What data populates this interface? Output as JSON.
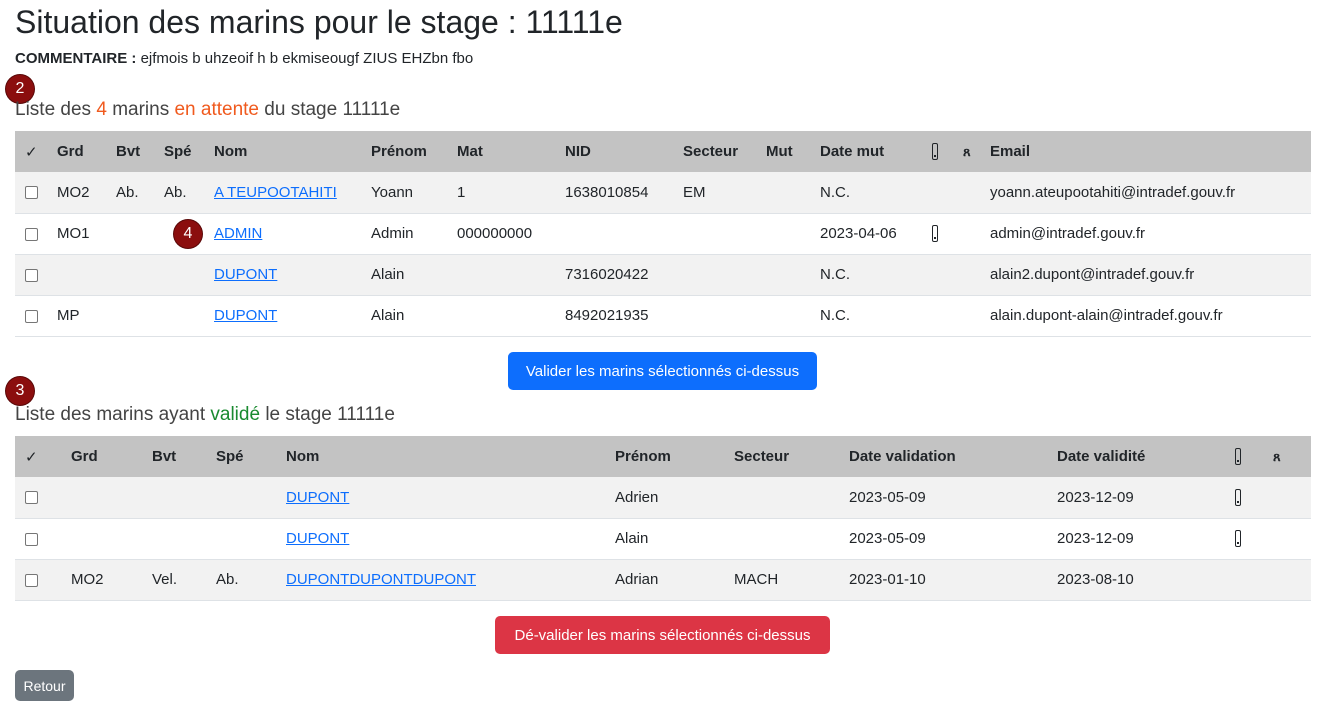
{
  "page": {
    "title": "Situation des marins pour le stage : 11111e",
    "comment_label": "COMMENTAIRE :",
    "comment_value": "ejfmois b uhzeoif h b ekmiseougf ZIUS EHZbn fbo"
  },
  "markers": [
    "2",
    "3",
    "4"
  ],
  "pending": {
    "title_prefix": "Liste des",
    "count": "4",
    "title_mid": "marins",
    "status": "en attente",
    "title_suffix": "du stage 11111e",
    "headers": {
      "check": "✓",
      "grd": "Grd",
      "bvt": "Bvt",
      "spe": "Spé",
      "nom": "Nom",
      "prenom": "Prénom",
      "mat": "Mat",
      "nid": "NID",
      "secteur": "Secteur",
      "mut": "Mut",
      "date_mut": "Date mut",
      "email": "Email"
    },
    "rows": [
      {
        "grd": "MO2",
        "bvt": "Ab.",
        "spe": "Ab.",
        "nom": "A TEUPOOTAHITI",
        "prenom": "Yoann",
        "mat": "1",
        "nid": "1638010854",
        "secteur": "EM",
        "mut": "",
        "date_mut": "N.C.",
        "excl": false,
        "email": "yoann.ateupootahiti@intradef.gouv.fr"
      },
      {
        "grd": "MO1",
        "bvt": "",
        "spe": "",
        "nom": "ADMIN",
        "prenom": "Admin",
        "mat": "000000000",
        "nid": "",
        "secteur": "",
        "mut": "",
        "date_mut": "2023-04-06",
        "excl": true,
        "email": "admin@intradef.gouv.fr"
      },
      {
        "grd": "",
        "bvt": "",
        "spe": "",
        "nom": "DUPONT",
        "prenom": "Alain",
        "mat": "",
        "nid": "7316020422",
        "secteur": "",
        "mut": "",
        "date_mut": "N.C.",
        "excl": false,
        "email": "alain2.dupont@intradef.gouv.fr"
      },
      {
        "grd": "MP",
        "bvt": "",
        "spe": "",
        "nom": "DUPONT",
        "prenom": "Alain",
        "mat": "",
        "nid": "8492021935",
        "secteur": "",
        "mut": "",
        "date_mut": "N.C.",
        "excl": false,
        "email": "alain.dupont-alain@intradef.gouv.fr"
      }
    ],
    "validate_button": "Valider les marins sélectionnés ci-dessus"
  },
  "validated": {
    "title_prefix": "Liste des marins ayant",
    "status": "validé",
    "title_suffix": "le stage 11111e",
    "headers": {
      "check": "✓",
      "grd": "Grd",
      "bvt": "Bvt",
      "spe": "Spé",
      "nom": "Nom",
      "prenom": "Prénom",
      "secteur": "Secteur",
      "date_validation": "Date validation",
      "date_validite": "Date validité"
    },
    "rows": [
      {
        "grd": "",
        "bvt": "",
        "spe": "",
        "nom": "DUPONT",
        "prenom": "Adrien",
        "secteur": "",
        "date_validation": "2023-05-09",
        "date_validite": "2023-12-09",
        "excl": true
      },
      {
        "grd": "",
        "bvt": "",
        "spe": "",
        "nom": "DUPONT",
        "prenom": "Alain",
        "secteur": "",
        "date_validation": "2023-05-09",
        "date_validite": "2023-12-09",
        "excl": true
      },
      {
        "grd": "MO2",
        "bvt": "Vel.",
        "spe": "Ab.",
        "nom": "DUPONTDUPONTDUPONT",
        "prenom": "Adrian",
        "secteur": "MACH",
        "date_validation": "2023-01-10",
        "date_validite": "2023-08-10",
        "excl": false
      }
    ],
    "unvalidate_button": "Dé-valider les marins sélectionnés ci-dessus"
  },
  "back_button": "Retour",
  "icons": {
    "excl": "exclamation-icon",
    "person": "person-icon"
  },
  "colors": {
    "primary": "#0d6efd",
    "danger": "#dc3545",
    "secondary": "#6c757d",
    "pending_status": "#f05a1e",
    "validated_status": "#198a2f",
    "marker": "#8b0e0e"
  }
}
